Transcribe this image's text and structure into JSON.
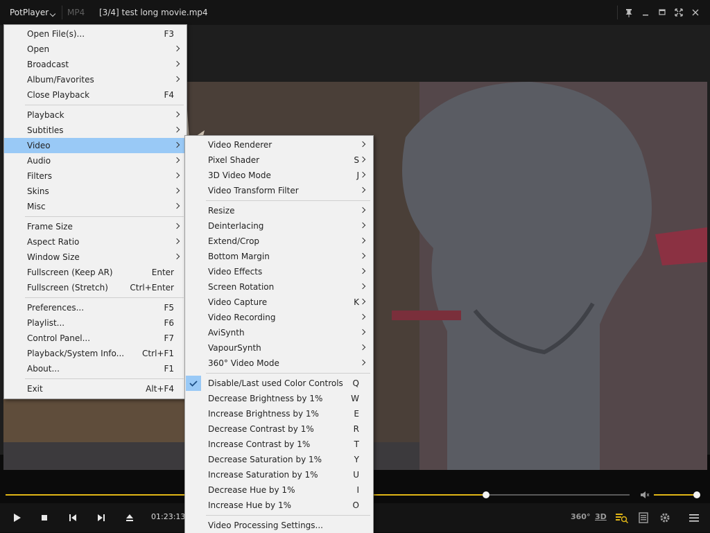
{
  "app": {
    "logo_text": "PotPlayer",
    "format_badge": "MP4",
    "window_title": "[3/4] test long movie.mp4"
  },
  "main_menu": {
    "items": [
      {
        "label": "Open File(s)...",
        "shortcut": "F3"
      },
      {
        "label": "Open",
        "submenu": true
      },
      {
        "label": "Broadcast",
        "submenu": true
      },
      {
        "label": "Album/Favorites",
        "submenu": true
      },
      {
        "label": "Close Playback",
        "shortcut": "F4"
      },
      {
        "label": "Playback",
        "submenu": true
      },
      {
        "label": "Subtitles",
        "submenu": true
      },
      {
        "label": "Video",
        "submenu": true,
        "highlighted": true
      },
      {
        "label": "Audio",
        "submenu": true
      },
      {
        "label": "Filters",
        "submenu": true
      },
      {
        "label": "Skins",
        "submenu": true
      },
      {
        "label": "Misc",
        "submenu": true
      },
      {
        "label": "Frame Size",
        "submenu": true
      },
      {
        "label": "Aspect Ratio",
        "submenu": true
      },
      {
        "label": "Window Size",
        "submenu": true
      },
      {
        "label": "Fullscreen (Keep AR)",
        "shortcut": "Enter"
      },
      {
        "label": "Fullscreen (Stretch)",
        "shortcut": "Ctrl+Enter"
      },
      {
        "label": "Preferences...",
        "shortcut": "F5"
      },
      {
        "label": "Playlist...",
        "shortcut": "F6"
      },
      {
        "label": "Control Panel...",
        "shortcut": "F7"
      },
      {
        "label": "Playback/System Info...",
        "shortcut": "Ctrl+F1"
      },
      {
        "label": "About...",
        "shortcut": "F1"
      },
      {
        "label": "Exit",
        "shortcut": "Alt+F4"
      }
    ]
  },
  "video_submenu": {
    "items": [
      {
        "label": "Video Renderer",
        "submenu": true
      },
      {
        "label": "Pixel Shader",
        "shortcut": "S",
        "submenu": true
      },
      {
        "label": "3D Video Mode",
        "shortcut": "J",
        "submenu": true
      },
      {
        "label": "Video Transform Filter",
        "submenu": true
      },
      {
        "label": "Resize",
        "submenu": true
      },
      {
        "label": "Deinterlacing",
        "submenu": true
      },
      {
        "label": "Extend/Crop",
        "submenu": true
      },
      {
        "label": "Bottom Margin",
        "submenu": true
      },
      {
        "label": "Video Effects",
        "submenu": true
      },
      {
        "label": "Screen Rotation",
        "submenu": true
      },
      {
        "label": "Video Capture",
        "shortcut": "K",
        "submenu": true
      },
      {
        "label": "Video Recording",
        "submenu": true
      },
      {
        "label": "AviSynth",
        "submenu": true
      },
      {
        "label": "VapourSynth",
        "submenu": true
      },
      {
        "label": "360° Video Mode",
        "submenu": true
      },
      {
        "label": "Disable/Last used Color Controls",
        "shortcut": "Q",
        "checked": true
      },
      {
        "label": "Decrease Brightness by 1%",
        "shortcut": "W"
      },
      {
        "label": "Increase Brightness by 1%",
        "shortcut": "E"
      },
      {
        "label": "Decrease Contrast by 1%",
        "shortcut": "R"
      },
      {
        "label": "Increase Contrast by 1%",
        "shortcut": "T"
      },
      {
        "label": "Decrease Saturation by 1%",
        "shortcut": "Y"
      },
      {
        "label": "Increase Saturation by 1%",
        "shortcut": "U"
      },
      {
        "label": "Decrease Hue by 1%",
        "shortcut": "I"
      },
      {
        "label": "Increase Hue by 1%",
        "shortcut": "O"
      },
      {
        "label": "Video Processing Settings..."
      }
    ]
  },
  "playback": {
    "time": "01:23:13",
    "seek_fraction": 0.77,
    "volume_fraction": 1.0
  },
  "controls": {
    "badge_360": "360°",
    "badge_3d": "3D"
  },
  "colors": {
    "accent": "#e1b617",
    "menu_highlight": "#99c9f6",
    "menu_bg": "#f1f1f1"
  }
}
